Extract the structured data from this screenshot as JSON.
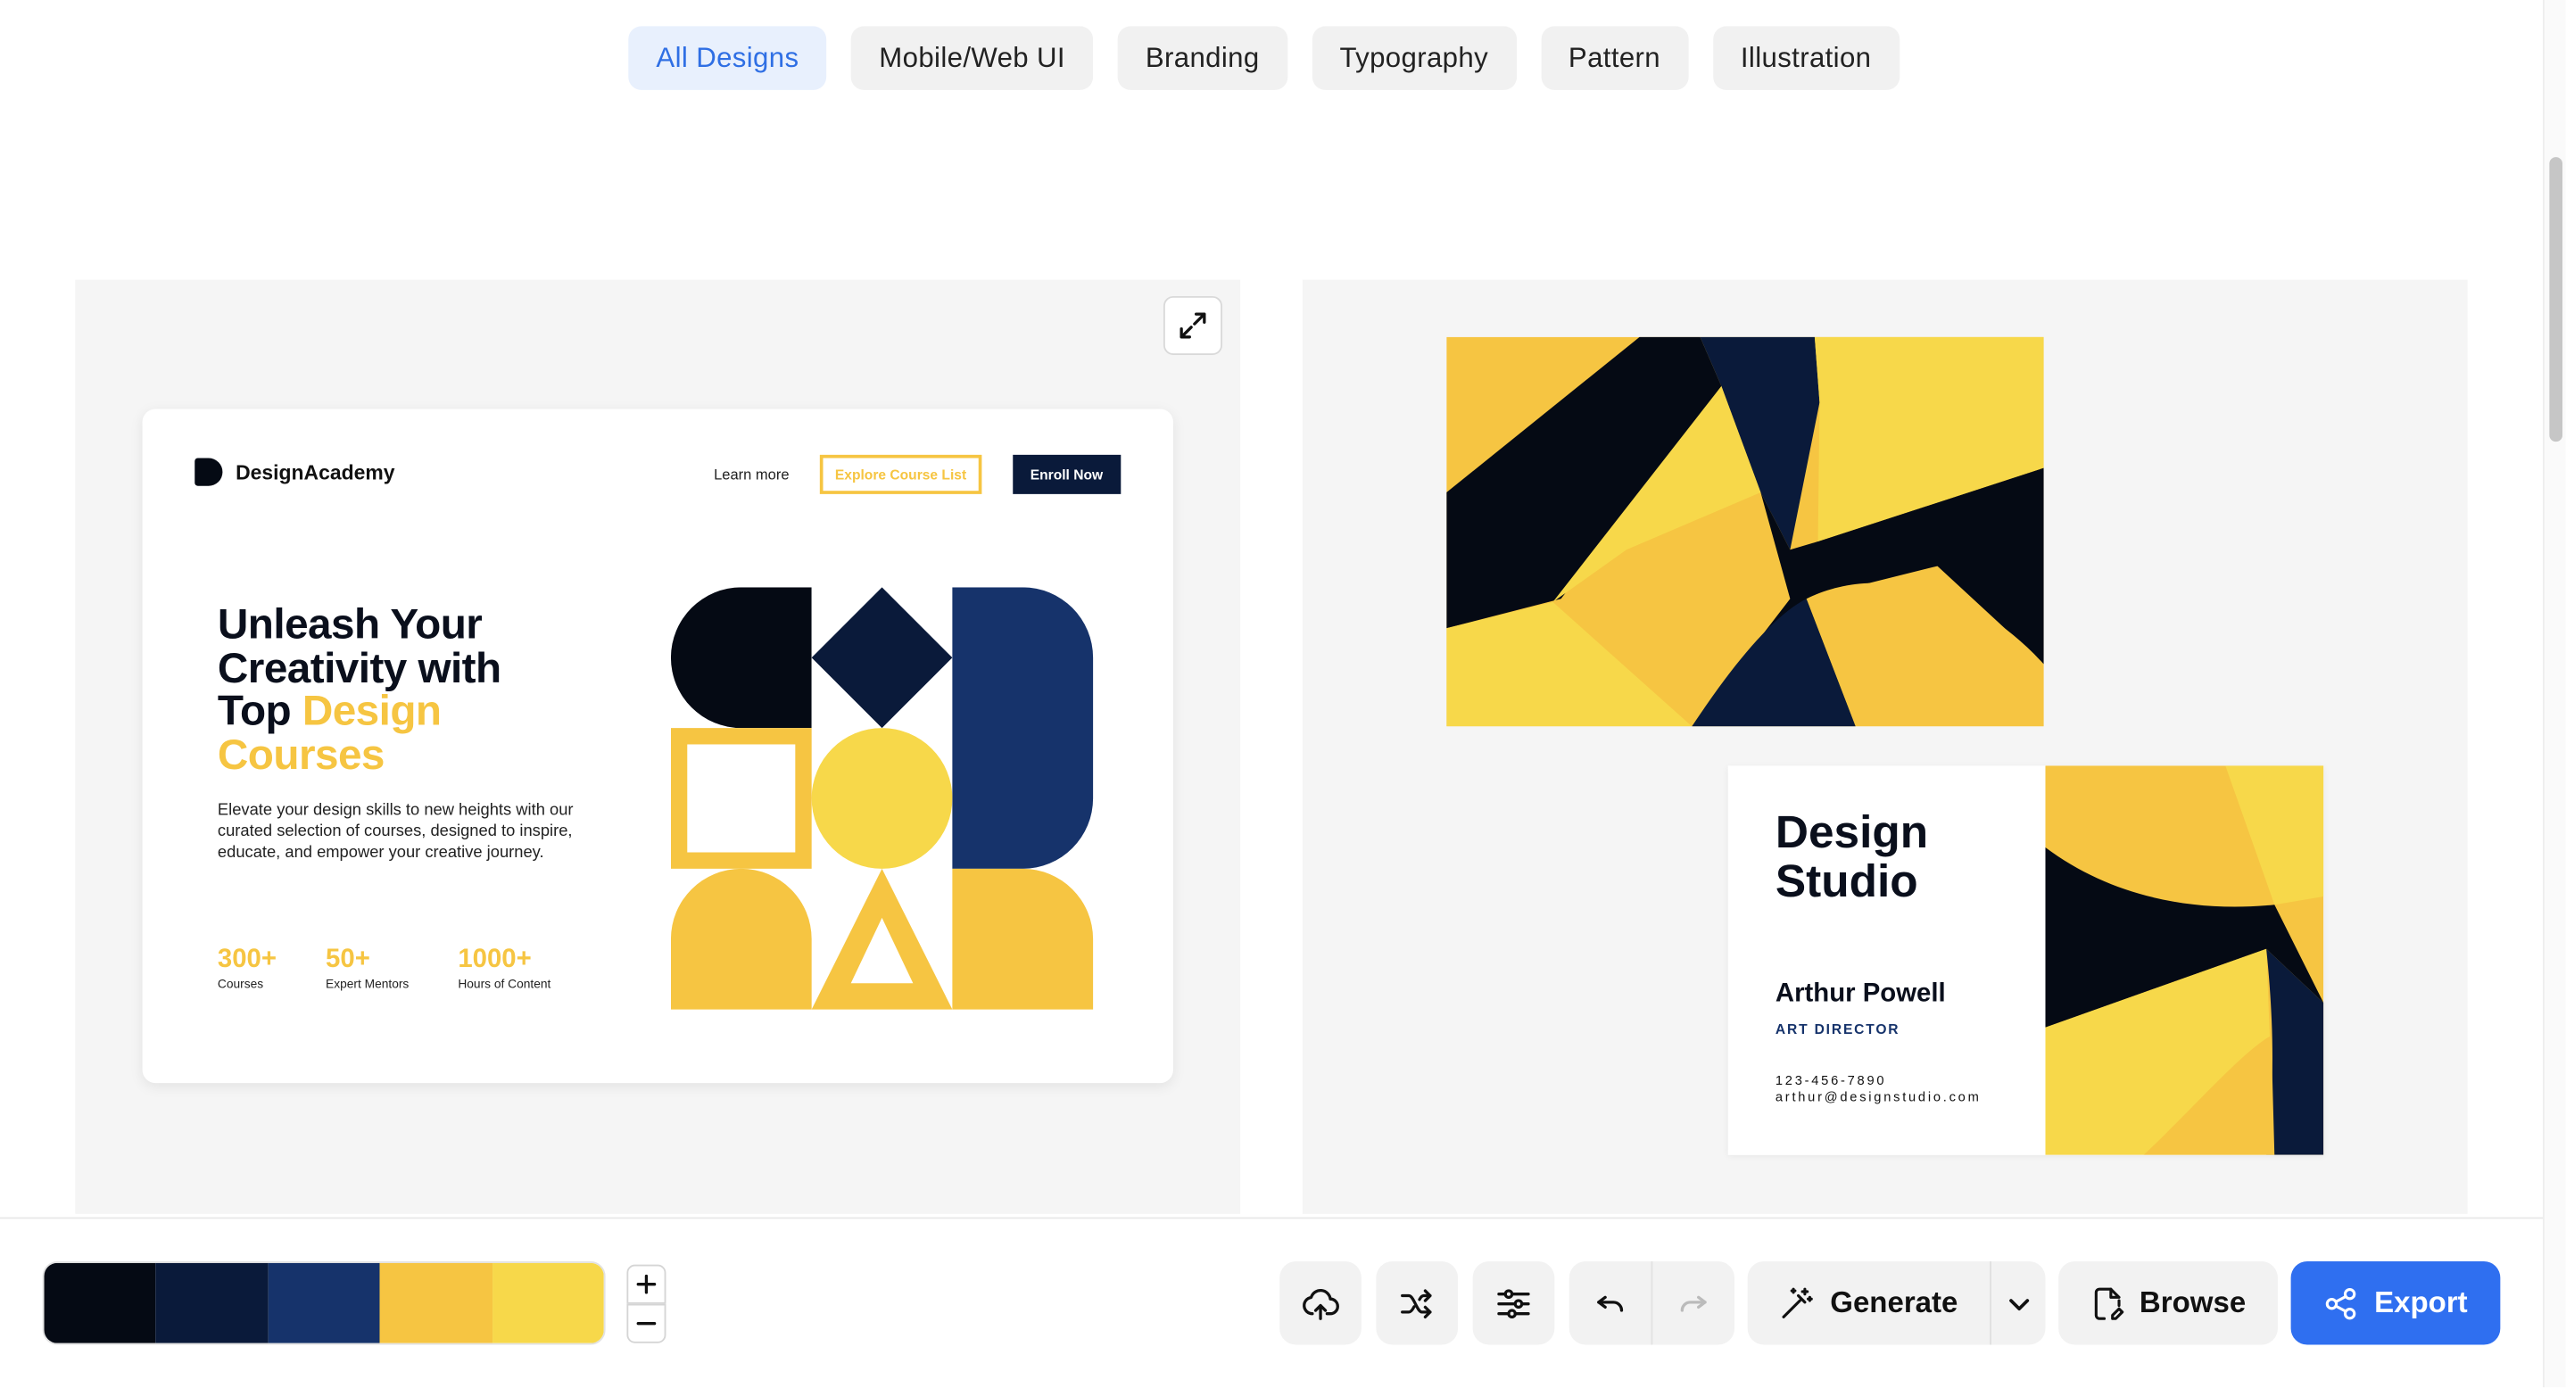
{
  "filters": [
    {
      "label": "All Designs",
      "active": true
    },
    {
      "label": "Mobile/Web UI"
    },
    {
      "label": "Branding"
    },
    {
      "label": "Typography"
    },
    {
      "label": "Pattern"
    },
    {
      "label": "Illustration"
    }
  ],
  "landing": {
    "brand": "DesignAcademy",
    "nav_learn": "Learn more",
    "nav_explore": "Explore Course List",
    "nav_enroll": "Enroll Now",
    "headline_1": "Unleash Your",
    "headline_2": "Creativity with",
    "headline_3a": "Top ",
    "headline_3b": "Design",
    "headline_4": "Courses",
    "description": "Elevate your design skills to new heights with our curated selection of courses, designed to inspire, educate, and empower your creative journey.",
    "stats": [
      {
        "num": "300+",
        "label": "Courses"
      },
      {
        "num": "50+",
        "label": "Expert Mentors"
      },
      {
        "num": "1000+",
        "label": "Hours of Content"
      }
    ]
  },
  "business_card": {
    "title_1": "Design",
    "title_2": "Studio",
    "name": "Arthur Powell",
    "role": "ART DIRECTOR",
    "phone": "123-456-7890",
    "email": "arthur@designstudio.com"
  },
  "palette": [
    "#050a14",
    "#0a1a3a",
    "#16336b",
    "#f6c542",
    "#f7d84a"
  ],
  "toolbar": {
    "generate_label": "Generate",
    "browse_label": "Browse",
    "export_label": "Export"
  },
  "icons": {
    "expand": "expand-icon",
    "upload": "cloud-upload-icon",
    "shuffle": "shuffle-icon",
    "adjust": "sliders-icon",
    "undo": "undo-icon",
    "redo": "redo-icon",
    "generate": "magic-wand-icon",
    "dropdown": "chevron-down-icon",
    "browse": "document-icon",
    "export": "share-icon"
  }
}
